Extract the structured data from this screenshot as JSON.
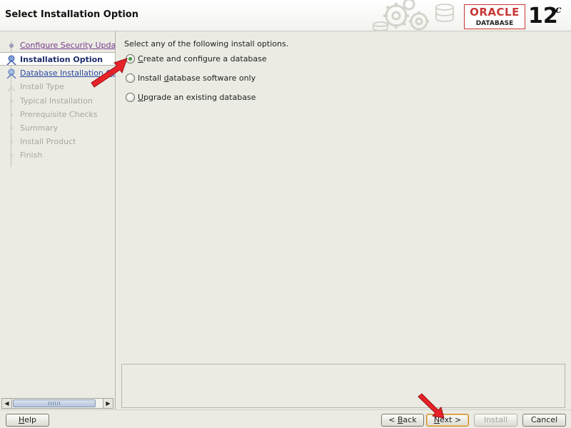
{
  "window": {
    "title": "Select Installation Option"
  },
  "logo": {
    "brand": "ORACLE",
    "product": "DATABASE",
    "version": "12",
    "version_suffix": "c"
  },
  "sidebar": {
    "steps": [
      {
        "label": "Configure Security Updates",
        "state": "visited"
      },
      {
        "label": "Installation Option",
        "state": "current"
      },
      {
        "label": "Database Installation Options",
        "state": "link"
      },
      {
        "label": "Install Type",
        "state": "disabled"
      },
      {
        "label": "Typical Installation",
        "state": "disabled"
      },
      {
        "label": "Prerequisite Checks",
        "state": "disabled"
      },
      {
        "label": "Summary",
        "state": "disabled"
      },
      {
        "label": "Install Product",
        "state": "disabled"
      },
      {
        "label": "Finish",
        "state": "disabled"
      }
    ]
  },
  "main": {
    "instruction": "Select any of the following install options.",
    "options": [
      {
        "mnemonic": "C",
        "rest": "reate and configure a database",
        "checked": true
      },
      {
        "before": "Install ",
        "mnemonic": "d",
        "rest": "atabase software only",
        "checked": false
      },
      {
        "mnemonic": "U",
        "rest": "pgrade an existing database",
        "checked": false
      }
    ]
  },
  "footer": {
    "help": {
      "mnemonic": "H",
      "rest": "elp"
    },
    "back": {
      "prefix": "< ",
      "mnemonic": "B",
      "rest": "ack"
    },
    "next": {
      "mnemonic": "N",
      "rest": "ext >"
    },
    "install": "Install",
    "cancel": "Cancel"
  },
  "colors": {
    "oracle_red": "#c73734",
    "annotation_arrow": "#e8222a",
    "radio_selected": "#3d9a3d"
  }
}
